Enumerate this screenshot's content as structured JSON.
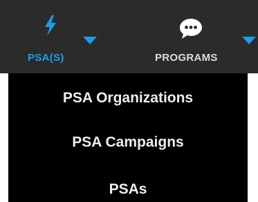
{
  "nav": {
    "items": [
      {
        "label": "PSA(S)",
        "icon": "lightning-bolt-icon",
        "active": true,
        "caret_icon": "caret-down-icon"
      },
      {
        "label": "PROGRAMS",
        "icon": "chat-bubble-icon",
        "active": false,
        "caret_icon": "caret-down-icon"
      }
    ]
  },
  "dropdown": {
    "items": [
      {
        "label": "PSA Organizations"
      },
      {
        "label": "PSA Campaigns"
      },
      {
        "label": "PSAs"
      }
    ]
  },
  "colors": {
    "navbar_bg": "#2b2b2b",
    "accent": "#1a9ee8",
    "inactive_text": "#dcdcdc",
    "dropdown_bg": "#000000",
    "dropdown_text": "#eeeeee"
  }
}
